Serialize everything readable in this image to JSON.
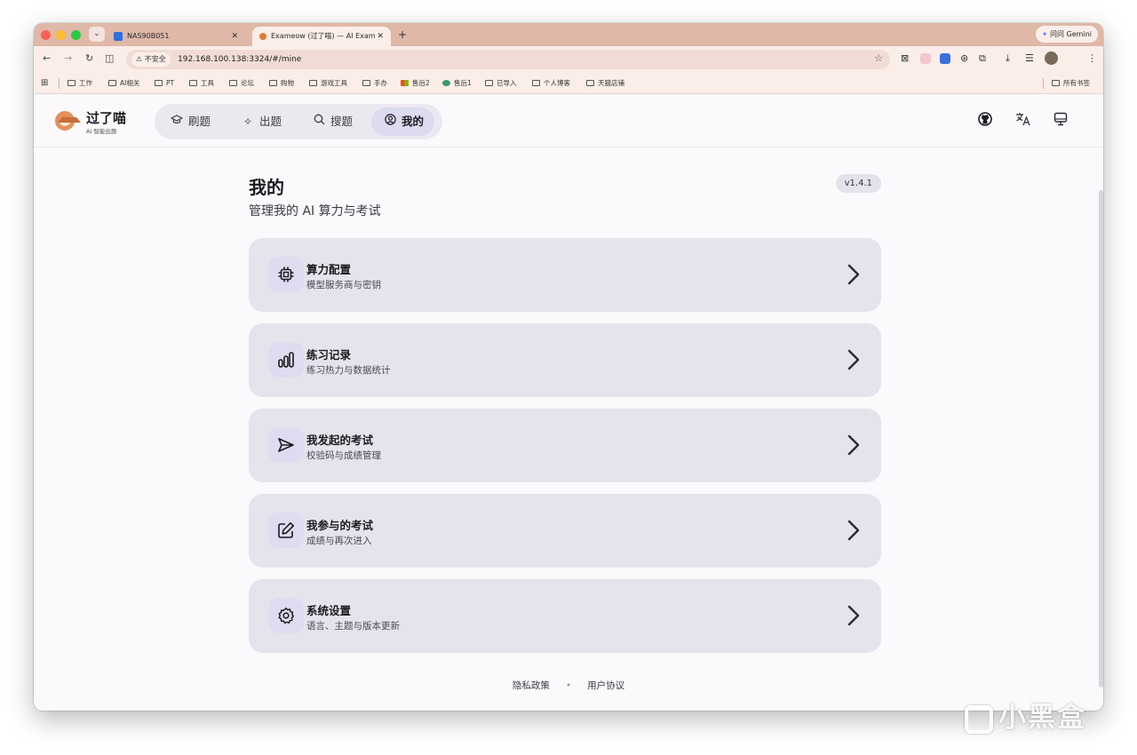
{
  "browser": {
    "tabs": [
      {
        "title": "NAS90B051"
      },
      {
        "title": "Exameow (过了喵) — AI Exam",
        "active": true
      }
    ],
    "gemini_label": "问问 Gemini",
    "security_label": "不安全",
    "url": "192.168.100.138:3324/#/mine",
    "bookmarks": [
      "工作",
      "AI相关",
      "PT",
      "工具",
      "论坛",
      "购物",
      "游戏工具",
      "手办",
      "售后2",
      "售后1",
      "已导入",
      "个人博客",
      "天猫店铺"
    ],
    "all_bookmarks_label": "所有书签"
  },
  "app": {
    "brand_name": "过了喵",
    "brand_sub": "AI 智能出题",
    "nav": [
      {
        "label": "刷题",
        "icon": "graduation-cap-icon"
      },
      {
        "label": "出题",
        "icon": "sparkles-icon"
      },
      {
        "label": "搜题",
        "icon": "search-icon"
      },
      {
        "label": "我的",
        "icon": "user-circle-icon",
        "active": true
      }
    ],
    "header_icons": [
      "github-icon",
      "translate-icon",
      "monitor-icon"
    ]
  },
  "page": {
    "title": "我的",
    "subtitle": "管理我的 AI 算力与考试",
    "version": "v1.4.1",
    "cards": [
      {
        "title": "算力配置",
        "desc": "模型服务商与密钥",
        "icon": "cpu-icon"
      },
      {
        "title": "练习记录",
        "desc": "练习热力与数据统计",
        "icon": "bar-chart-icon"
      },
      {
        "title": "我发起的考试",
        "desc": "校验码与成绩管理",
        "icon": "send-icon"
      },
      {
        "title": "我参与的考试",
        "desc": "成绩与再次进入",
        "icon": "edit-icon"
      },
      {
        "title": "系统设置",
        "desc": "语言、主题与版本更新",
        "icon": "gear-icon"
      }
    ]
  },
  "footer": {
    "privacy": "隐私政策",
    "separator": "•",
    "terms": "用户协议"
  },
  "watermark": "小黑盒",
  "colors": {
    "tabstrip": "#dfb8a8",
    "toolbar": "#fbeee9",
    "page_bg": "#fbf9fc",
    "card_bg": "#e5e3eb",
    "nav_active": "#dcdbef"
  }
}
